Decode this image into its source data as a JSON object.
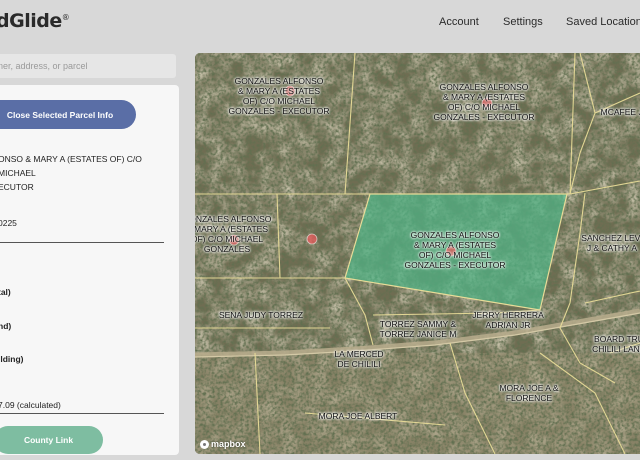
{
  "header": {
    "logo": "dGlide",
    "logo_mark": "®",
    "nav": [
      "Account",
      "Settings",
      "Saved Locations"
    ]
  },
  "search": {
    "placeholder": "ner, address, or parcel"
  },
  "panel": {
    "close_button": "Close Selected Parcel Info",
    "owner_line1": "ONSO & MARY A (ESTATES OF) C/O MICHAEL",
    "owner_line2": "ECUTOR",
    "parcel_number": "0225",
    "label_total": "tal)",
    "label_land": "nd)",
    "label_building": "ilding)",
    "acres": "7.09 (calculated)",
    "county_link": "County Link"
  },
  "map": {
    "attribution": "mapbox",
    "parcel_labels": [
      [
        "GONZALES ALFONSO",
        "& MARY A (ESTATES",
        "OF) C/O MICHAEL",
        "GONZALES - EXECUTOR"
      ],
      [
        "GONZALES ALFONSO",
        "& MARY A (ESTATES",
        "OF) C/O MICHAEL",
        "GONZALES - EXECUTOR"
      ],
      [
        "MCAFEE JO"
      ],
      [
        "GONZALES ALFONSO",
        "& MARY A (ESTATES",
        "OF) C/O MICHAEL",
        "GONZALES"
      ],
      [
        "GONZALES ALFONSO",
        "& MARY A (ESTATES",
        "OF) C/O MICHAEL",
        "GONZALES - EXECUTOR"
      ],
      [
        "SANCHEZ LEVI",
        "J & CATHY A"
      ],
      [
        "SENA JUDY TORREZ"
      ],
      [
        "TORREZ SAMMY &",
        "TORREZ JANICE M"
      ],
      [
        "JERRY HERRERA",
        "ADRIAN JR"
      ],
      [
        "BOARD TRU",
        "CHILILI LAND"
      ],
      [
        "LA MERCED",
        "DE CHILILI"
      ],
      [
        "MORA JOE A &",
        "FLORENCE"
      ],
      [
        "MORA JOE ALBERT"
      ]
    ]
  },
  "colors": {
    "primary_button": "#5a6ea6",
    "county_button": "#7ebda1",
    "selected_parcel": "#4fb486",
    "parcel_line": "#e8dc98",
    "marker": "#e05a5a"
  }
}
